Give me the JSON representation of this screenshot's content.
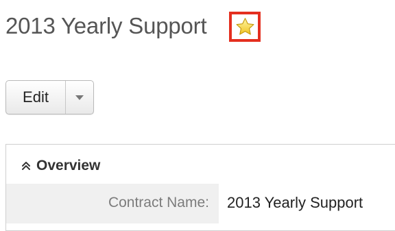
{
  "record": {
    "title": "2013 Yearly Support",
    "favorite_icon": "star-icon",
    "favorite_highlight_color": "#e42f1f"
  },
  "toolbar": {
    "edit_label": "Edit",
    "dropdown_icon": "chevron-down-icon"
  },
  "panel": {
    "title": "Overview",
    "collapse_icon": "double-chevron-up-icon",
    "fields": [
      {
        "label": "Contract Name:",
        "value": "2013 Yearly Support"
      }
    ]
  }
}
